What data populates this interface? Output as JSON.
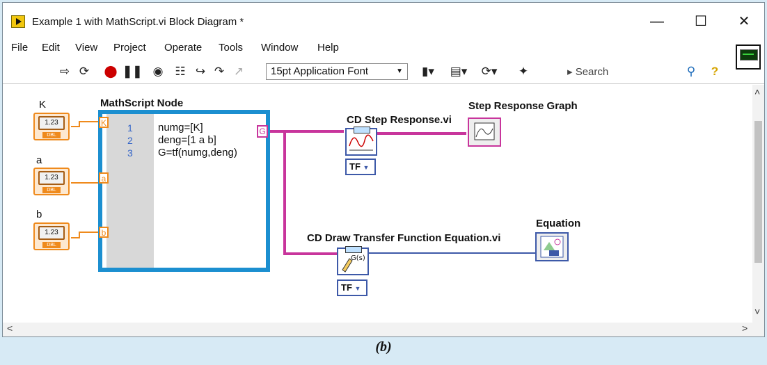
{
  "window": {
    "title": "Example 1 with MathScript.vi Block Diagram *",
    "minimize_icon": "minimize-icon",
    "maximize_icon": "maximize-icon",
    "close_icon": "close-icon"
  },
  "menu": [
    "File",
    "Edit",
    "View",
    "Project",
    "Operate",
    "Tools",
    "Window",
    "Help"
  ],
  "toolbar": {
    "font": "15pt Application Font",
    "search_placeholder": "Search"
  },
  "diagram": {
    "controls": [
      {
        "label": "K",
        "value": "1.23",
        "type": "DBL"
      },
      {
        "label": "a",
        "value": "1.23",
        "type": "DBL"
      },
      {
        "label": "b",
        "value": "1.23",
        "type": "DBL"
      }
    ],
    "mathscript": {
      "title": "MathScript Node",
      "inputs": [
        "K",
        "a",
        "b"
      ],
      "output": "G",
      "lines": [
        {
          "num": "1",
          "code": "numg=[K]"
        },
        {
          "num": "2",
          "code": "deng=[1 a b]"
        },
        {
          "num": "3",
          "code": "G=tf(numg,deng)"
        }
      ]
    },
    "step_vi": {
      "label": "CD Step Response.vi",
      "selector": "TF"
    },
    "draw_vi": {
      "label": "CD Draw Transfer Function Equation.vi",
      "selector": "TF"
    },
    "graph": {
      "label": "Step Response Graph"
    },
    "equation": {
      "label": "Equation"
    }
  },
  "caption": "(b)",
  "colors": {
    "numeric_wire": "#ef8a1c",
    "model_wire": "#c8359c",
    "image_wire": "#3d59a8",
    "mathscript_border": "#1c8fd0"
  }
}
